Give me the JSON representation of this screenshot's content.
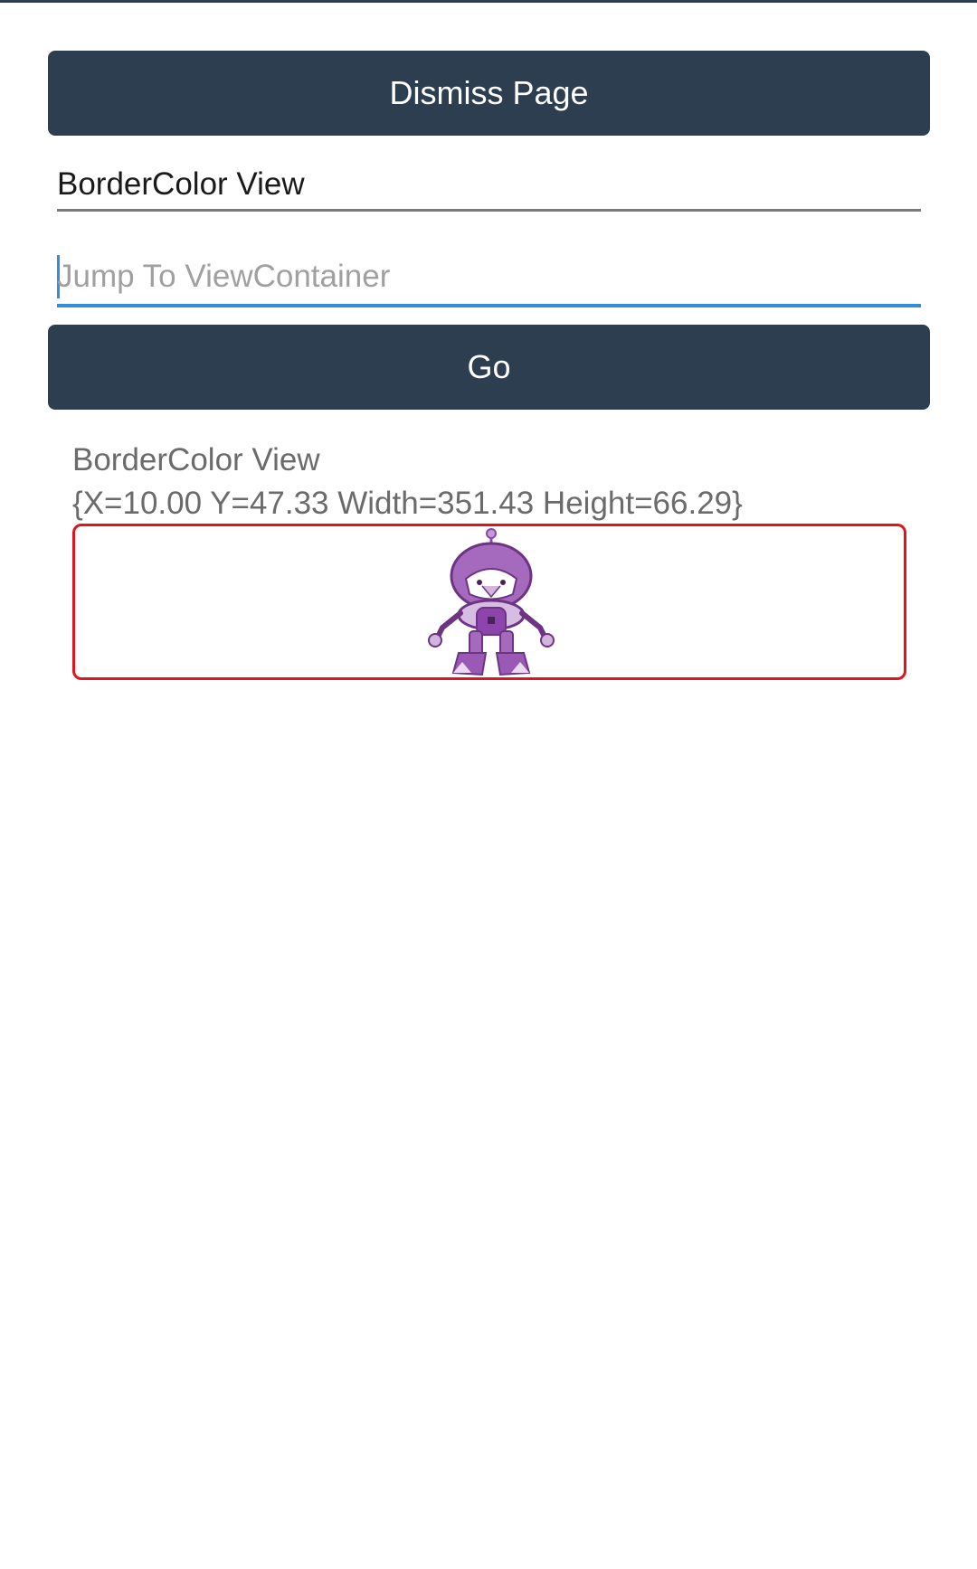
{
  "toolbar": {
    "dismiss_label": "Dismiss Page",
    "go_label": "Go"
  },
  "entries": {
    "current_value": "BorderColor View",
    "search_placeholder": "Jump To ViewContainer"
  },
  "info": {
    "title": "BorderColor View",
    "bounds": "{X=10.00 Y=47.33 Width=351.43 Height=66.29}"
  },
  "view": {
    "border_color": "#e0141e",
    "image_icon": "dotnet-bot-icon",
    "image_accent_color": "#9b59b6"
  },
  "theme": {
    "button_bg": "#2d3e50",
    "focus_color": "#2f8fd8"
  }
}
